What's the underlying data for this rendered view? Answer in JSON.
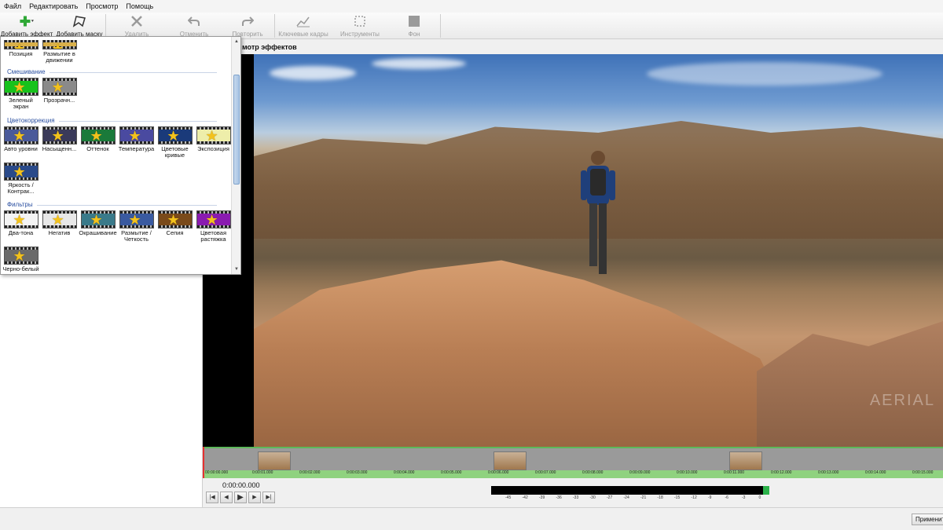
{
  "menu": [
    "Файл",
    "Редактировать",
    "Просмотр",
    "Помощь"
  ],
  "toolbar": {
    "add_effect": "Добавить эффект",
    "add_mask": "Добавить маску",
    "delete": "Удалить",
    "undo": "Отменить",
    "redo": "Повторить",
    "keyframes": "Ключевые кадры",
    "tools": "Инструменты",
    "background": "Фон"
  },
  "preview": {
    "title": "мотр эффектов",
    "watermark": "AERIAL"
  },
  "effects_popup": {
    "categories": {
      "blending": "Смешивание",
      "color_correction": "Цветокоррекция",
      "filters": "Фильтры"
    },
    "top_row": [
      {
        "name": "Позиция",
        "icon": "position-effect-icon"
      },
      {
        "name": "Размытие в движении",
        "icon": "motion-blur-effect-icon"
      }
    ],
    "blending": [
      {
        "name": "Зеленый экран",
        "icon": "green-screen-effect-icon",
        "bg": "#17c21c"
      },
      {
        "name": "Прозрачн...",
        "icon": "transparency-effect-icon",
        "bg": "#8a8a8a"
      }
    ],
    "color_correction": [
      {
        "name": "Авто уровни",
        "icon": "auto-levels-effect-icon",
        "bg": "#4a5a9a"
      },
      {
        "name": "Насыщенн...",
        "icon": "saturation-effect-icon",
        "bg": "#3a3a5a"
      },
      {
        "name": "Оттенок",
        "icon": "hue-effect-icon",
        "bg": "#1a7a3a"
      },
      {
        "name": "Температура",
        "icon": "temperature-effect-icon",
        "bg": "#4a4aa0"
      },
      {
        "name": "Цветовые кривые",
        "icon": "color-curves-effect-icon",
        "bg": "#1a3a7a"
      },
      {
        "name": "Экспозиция",
        "icon": "exposure-effect-icon",
        "bg": "#eeeeaa"
      },
      {
        "name": "Яркость / Контрак...",
        "icon": "brightness-contrast-effect-icon",
        "bg": "#2a4a8a"
      }
    ],
    "filters": [
      {
        "name": "Два-тона",
        "icon": "duotone-effect-icon",
        "bg": "#f4f4f4"
      },
      {
        "name": "Негатив",
        "icon": "negative-effect-icon",
        "bg": "#e8e8e8"
      },
      {
        "name": "Окрашивание",
        "icon": "tint-effect-icon",
        "bg": "#3a7a8a"
      },
      {
        "name": "Размытие / Четкость",
        "icon": "blur-sharpen-effect-icon",
        "bg": "#3a5aa0"
      },
      {
        "name": "Сепия",
        "icon": "sepia-effect-icon",
        "bg": "#7a4a1a"
      },
      {
        "name": "Цветовая растяжка",
        "icon": "color-stretch-effect-icon",
        "bg": "#8a1ab0"
      },
      {
        "name": "Черно-белый",
        "icon": "black-white-effect-icon",
        "bg": "#6a6a6a"
      }
    ]
  },
  "timeline": {
    "ticks": [
      "00:00:00.000",
      "0:00:01.000",
      "0:00:02.000",
      "0:00:03.000",
      "0:00:04.000",
      "0:00:05.000",
      "0:00:06.000",
      "0:00:07.000",
      "0:00:08.000",
      "0:00:09.000",
      "0:00:10.000",
      "0:00:11.000",
      "0:00:12.000",
      "0:00:13.000",
      "0:00:14.000",
      "0:00:15.000"
    ]
  },
  "controls": {
    "timecode": "0:00:00.000",
    "meter_ticks": [
      "-45",
      "-42",
      "-39",
      "-36",
      "-33",
      "-30",
      "-27",
      "-24",
      "-21",
      "-18",
      "-15",
      "-12",
      "-9",
      "-6",
      "-3",
      "0"
    ]
  },
  "apply_button": "Применить"
}
